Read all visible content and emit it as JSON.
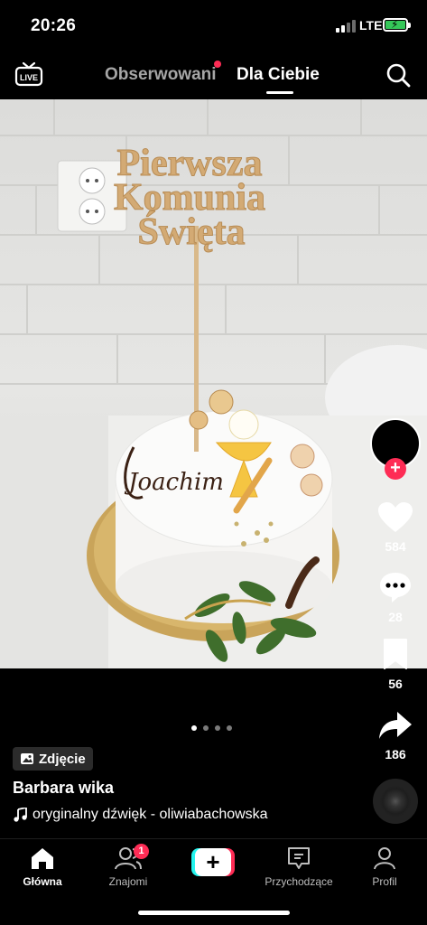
{
  "status_bar": {
    "time": "20:26",
    "network": "LTE",
    "battery_color": "#35c759"
  },
  "top_nav": {
    "live_label": "LIVE",
    "tabs": [
      {
        "label": "Obserwowani",
        "active": false,
        "has_dot": true
      },
      {
        "label": "Dla Ciebie",
        "active": true
      }
    ],
    "icons": {
      "live": "live-tv-icon",
      "search": "search-icon"
    }
  },
  "post": {
    "photo_description_icon": "photo-icon",
    "topper_text": [
      "Pierwsza",
      "Komunia",
      "Święta"
    ],
    "cake_script_text": "Joachim",
    "carousel": {
      "count": 4,
      "active_index": 0
    },
    "type_tag": "Zdjęcie",
    "author": "Barbara wika",
    "sound": "oryginalny dźwięk - oliwiabachowska"
  },
  "actions": {
    "likes": "584",
    "comments": "28",
    "saves": "56",
    "shares": "186",
    "icons": {
      "like": "heart-icon",
      "comment": "comment-icon",
      "save": "bookmark-icon",
      "share": "share-arrow-icon",
      "follow": "plus-icon"
    }
  },
  "bottom_nav": {
    "items": [
      {
        "label": "Główna",
        "icon": "home-icon",
        "active": true
      },
      {
        "label": "Znajomi",
        "icon": "friends-icon",
        "badge": "1"
      },
      {
        "label": "",
        "icon": "create-plus-icon"
      },
      {
        "label": "Przychodzące",
        "icon": "inbox-icon"
      },
      {
        "label": "Profil",
        "icon": "profile-icon"
      }
    ]
  },
  "colors": {
    "accent": "#fe2c55",
    "cyan": "#25f4ee",
    "background": "#000000"
  }
}
